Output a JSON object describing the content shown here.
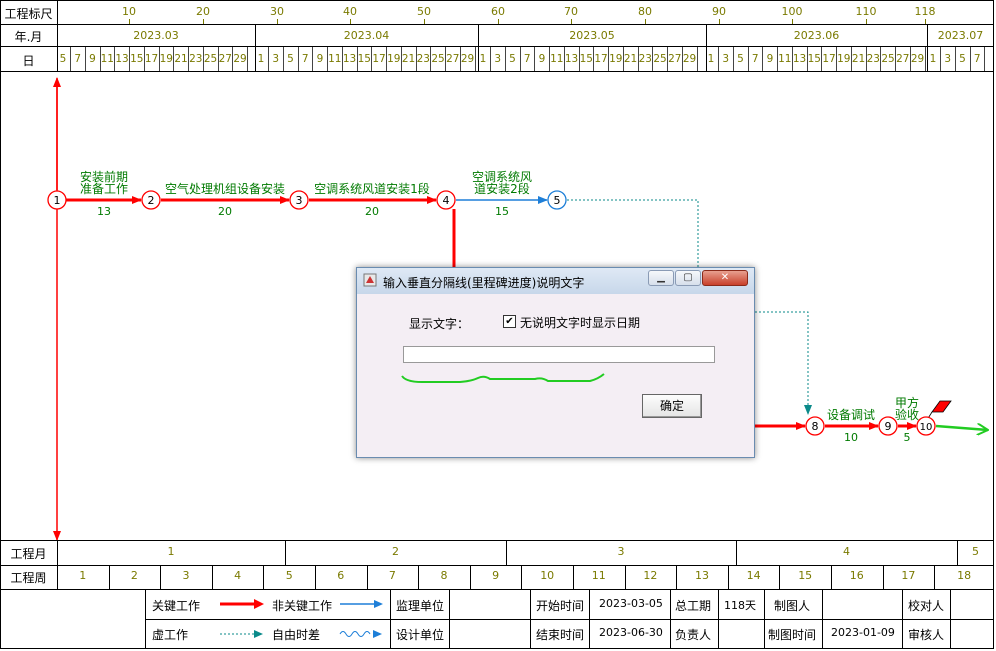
{
  "app": {
    "scale_label": "工程标尺",
    "month_label": "年.月",
    "day_label": "日",
    "project_month_label": "工程月",
    "project_week_label": "工程周"
  },
  "scale_ticks": [
    "10",
    "20",
    "30",
    "40",
    "50",
    "60",
    "70",
    "80",
    "90",
    "100",
    "110",
    "118"
  ],
  "months": [
    "2023.03",
    "2023.04",
    "2023.05",
    "2023.06",
    "2023.07"
  ],
  "days_groups": [
    [
      "5",
      "7",
      "9",
      "11",
      "13",
      "15",
      "17",
      "19",
      "21",
      "23",
      "25",
      "27",
      "29"
    ],
    [
      "1",
      "3",
      "5",
      "7",
      "9",
      "11",
      "13",
      "15",
      "17",
      "19",
      "21",
      "23",
      "25",
      "27",
      "29"
    ],
    [
      "1",
      "3",
      "5",
      "7",
      "9",
      "11",
      "13",
      "15",
      "17",
      "19",
      "21",
      "23",
      "25",
      "27",
      "29"
    ],
    [
      "1",
      "3",
      "5",
      "7",
      "9",
      "11",
      "13",
      "15",
      "17",
      "19",
      "21",
      "23",
      "25",
      "27",
      "29"
    ],
    [
      "1",
      "3",
      "5",
      "7"
    ]
  ],
  "project_months": [
    "1",
    "2",
    "3",
    "4",
    "5"
  ],
  "project_weeks": [
    "1",
    "2",
    "3",
    "4",
    "5",
    "6",
    "7",
    "8",
    "9",
    "10",
    "11",
    "12",
    "13",
    "14",
    "15",
    "16",
    "17",
    "18"
  ],
  "nodes": [
    "1",
    "2",
    "3",
    "4",
    "5",
    "8",
    "9",
    "10"
  ],
  "tasks": [
    {
      "name_line1": "安装前期",
      "name_line2": "准备工作",
      "duration": "13"
    },
    {
      "name_line1": "空气处理机组设备安装",
      "name_line2": "",
      "duration": "20"
    },
    {
      "name_line1": "空调系统风道安装1段",
      "name_line2": "",
      "duration": "20"
    },
    {
      "name_line1": "空调系统风",
      "name_line2": "道安装2段",
      "duration": "15"
    },
    {
      "name_line1": "设备调试",
      "name_line2": "",
      "duration": "10"
    },
    {
      "name_line1": "甲方",
      "name_line2": "验收",
      "duration": "5"
    }
  ],
  "colors": {
    "critical": "#ff0000",
    "noncritical": "#1e7fd8",
    "dotted": "#0a8a8a",
    "task_text": "#007a00",
    "scale_text": "#7a7a00",
    "final_arrow": "#22cc22"
  },
  "legend": {
    "critical": "关键工作",
    "noncritical": "非关键工作",
    "supervisor": "监理单位",
    "dummy": "虚工作",
    "free_float": "自由时差",
    "design": "设计单位"
  },
  "info": {
    "start_label": "开始时间",
    "start_value": "2023-03-05",
    "end_label": "结束时间",
    "end_value": "2023-06-30",
    "duration_label": "总工期",
    "duration_value": "118天",
    "owner_label": "负责人",
    "drafter_label": "制图人",
    "draw_time_label": "制图时间",
    "draw_time_value": "2023-01-09",
    "checker_label": "校对人",
    "reviewer_label": "审核人"
  },
  "dialog": {
    "title": "输入垂直分隔线(里程碑进度)说明文字",
    "display_label": "显示文字：",
    "checkbox_label": "无说明文字时显示日期",
    "checkbox_checked": true,
    "input_value": "",
    "ok_label": "确定",
    "minimize_icon": "minimize-icon",
    "maximize_icon": "maximize-icon",
    "close_icon": "close-icon"
  }
}
